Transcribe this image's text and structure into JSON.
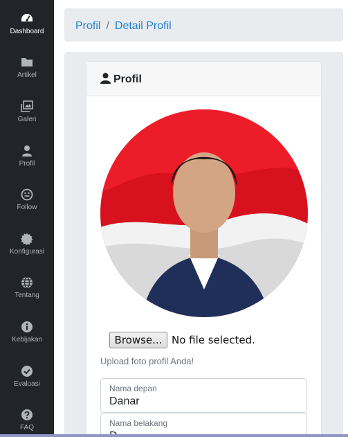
{
  "sidebar": {
    "items": [
      {
        "label": "Dashboard",
        "icon": "tachometer-icon"
      },
      {
        "label": "Artikel",
        "icon": "folder-icon"
      },
      {
        "label": "Galeri",
        "icon": "images-icon"
      },
      {
        "label": "Profil",
        "icon": "user-icon"
      },
      {
        "label": "Follow",
        "icon": "smile-icon"
      },
      {
        "label": "Konfigurasi",
        "icon": "cog-icon"
      },
      {
        "label": "Tentang",
        "icon": "globe-icon"
      },
      {
        "label": "Kebijakan",
        "icon": "info-icon"
      },
      {
        "label": "Evaluasi",
        "icon": "check-circle-icon"
      },
      {
        "label": "FAQ",
        "icon": "question-circle-icon"
      }
    ],
    "active": "Dashboard"
  },
  "breadcrumb": {
    "parent": "Profil",
    "separator": "/",
    "current": "Detail Profil"
  },
  "card": {
    "title": "Profil",
    "title_icon": "user-icon"
  },
  "upload": {
    "button_label": "Browse...",
    "status": "No file selected.",
    "hint": "Upload foto profil Anda!"
  },
  "form": {
    "first_name": {
      "label": "Nama depan",
      "value": "Danar"
    },
    "last_name": {
      "label": "Nama belakang",
      "value": "D"
    }
  },
  "colors": {
    "sidebar_bg": "#212529",
    "link": "#1a7fd6",
    "panel_bg": "#e9ecef"
  }
}
